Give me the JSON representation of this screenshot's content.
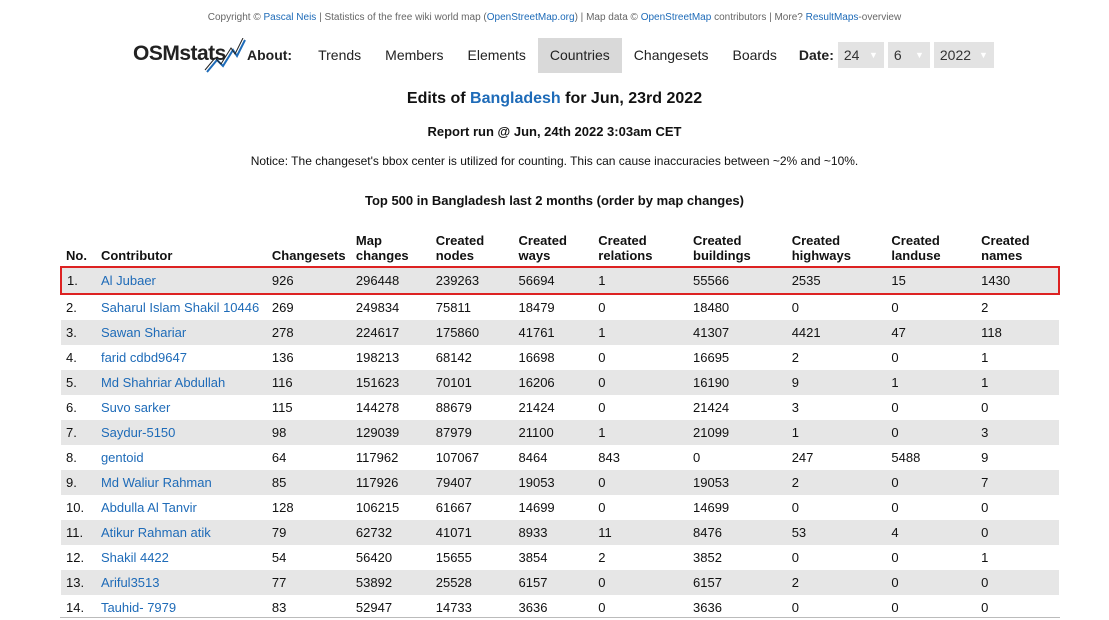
{
  "copyright": {
    "prefix": "Copyright © ",
    "author": "Pascal Neis",
    "mid1": " | Statistics of the free wiki world map (",
    "osm_link": "OpenStreetMap.org",
    "mid2": ") | Map data © ",
    "osm_link2": "OpenStreetMap",
    "mid3": " contributors | More? ",
    "resultmaps": "ResultMaps",
    "suffix": "-overview"
  },
  "logo": {
    "text": "OSMstats"
  },
  "nav": {
    "about": "About:",
    "items": [
      "Trends",
      "Members",
      "Elements",
      "Countries",
      "Changesets",
      "Boards"
    ],
    "active": "Countries"
  },
  "date": {
    "label": "Date:",
    "day": "24",
    "month": "6",
    "year": "2022"
  },
  "title": {
    "prefix": "Edits of ",
    "country": "Bangladesh",
    "suffix": " for Jun, 23rd 2022"
  },
  "report": "Report run @ Jun, 24th 2022 3:03am CET",
  "notice": "Notice: The changeset's bbox center is utilized for counting. This can cause inaccuracies between ~2% and ~10%.",
  "subtitle": "Top 500 in Bangladesh last 2 months (order by map changes)",
  "table": {
    "headers": [
      "No.",
      "Contributor",
      "Changesets",
      "Map changes",
      "Created nodes",
      "Created ways",
      "Created relations",
      "Created buildings",
      "Created highways",
      "Created landuse",
      "Created names"
    ],
    "rows": [
      [
        "1.",
        "Al Jubaer",
        "926",
        "296448",
        "239263",
        "56694",
        "1",
        "55566",
        "2535",
        "15",
        "1430"
      ],
      [
        "2.",
        "Saharul Islam Shakil 10446",
        "269",
        "249834",
        "75811",
        "18479",
        "0",
        "18480",
        "0",
        "0",
        "2"
      ],
      [
        "3.",
        "Sawan Shariar",
        "278",
        "224617",
        "175860",
        "41761",
        "1",
        "41307",
        "4421",
        "47",
        "118"
      ],
      [
        "4.",
        "farid cdbd9647",
        "136",
        "198213",
        "68142",
        "16698",
        "0",
        "16695",
        "2",
        "0",
        "1"
      ],
      [
        "5.",
        "Md Shahriar Abdullah",
        "116",
        "151623",
        "70101",
        "16206",
        "0",
        "16190",
        "9",
        "1",
        "1"
      ],
      [
        "6.",
        "Suvo sarker",
        "115",
        "144278",
        "88679",
        "21424",
        "0",
        "21424",
        "3",
        "0",
        "0"
      ],
      [
        "7.",
        "Saydur-5150",
        "98",
        "129039",
        "87979",
        "21100",
        "1",
        "21099",
        "1",
        "0",
        "3"
      ],
      [
        "8.",
        "gentoid",
        "64",
        "117962",
        "107067",
        "8464",
        "843",
        "0",
        "247",
        "5488",
        "9"
      ],
      [
        "9.",
        "Md Waliur Rahman",
        "85",
        "117926",
        "79407",
        "19053",
        "0",
        "19053",
        "2",
        "0",
        "7"
      ],
      [
        "10.",
        "Abdulla Al Tanvir",
        "128",
        "106215",
        "61667",
        "14699",
        "0",
        "14699",
        "0",
        "0",
        "0"
      ],
      [
        "11.",
        "Atikur Rahman atik",
        "79",
        "62732",
        "41071",
        "8933",
        "11",
        "8476",
        "53",
        "4",
        "0"
      ],
      [
        "12.",
        "Shakil 4422",
        "54",
        "56420",
        "15655",
        "3854",
        "2",
        "3852",
        "0",
        "0",
        "1"
      ],
      [
        "13.",
        "Ariful3513",
        "77",
        "53892",
        "25528",
        "6157",
        "0",
        "6157",
        "2",
        "0",
        "0"
      ],
      [
        "14.",
        "Tauhid- 7979",
        "83",
        "52947",
        "14733",
        "3636",
        "0",
        "3636",
        "0",
        "0",
        "0"
      ]
    ]
  },
  "colors": {
    "link": "#1e6bb8",
    "highlight_border": "#dd2222",
    "stripe": "#e6e6e6",
    "active_tab": "#d9d9d9"
  }
}
